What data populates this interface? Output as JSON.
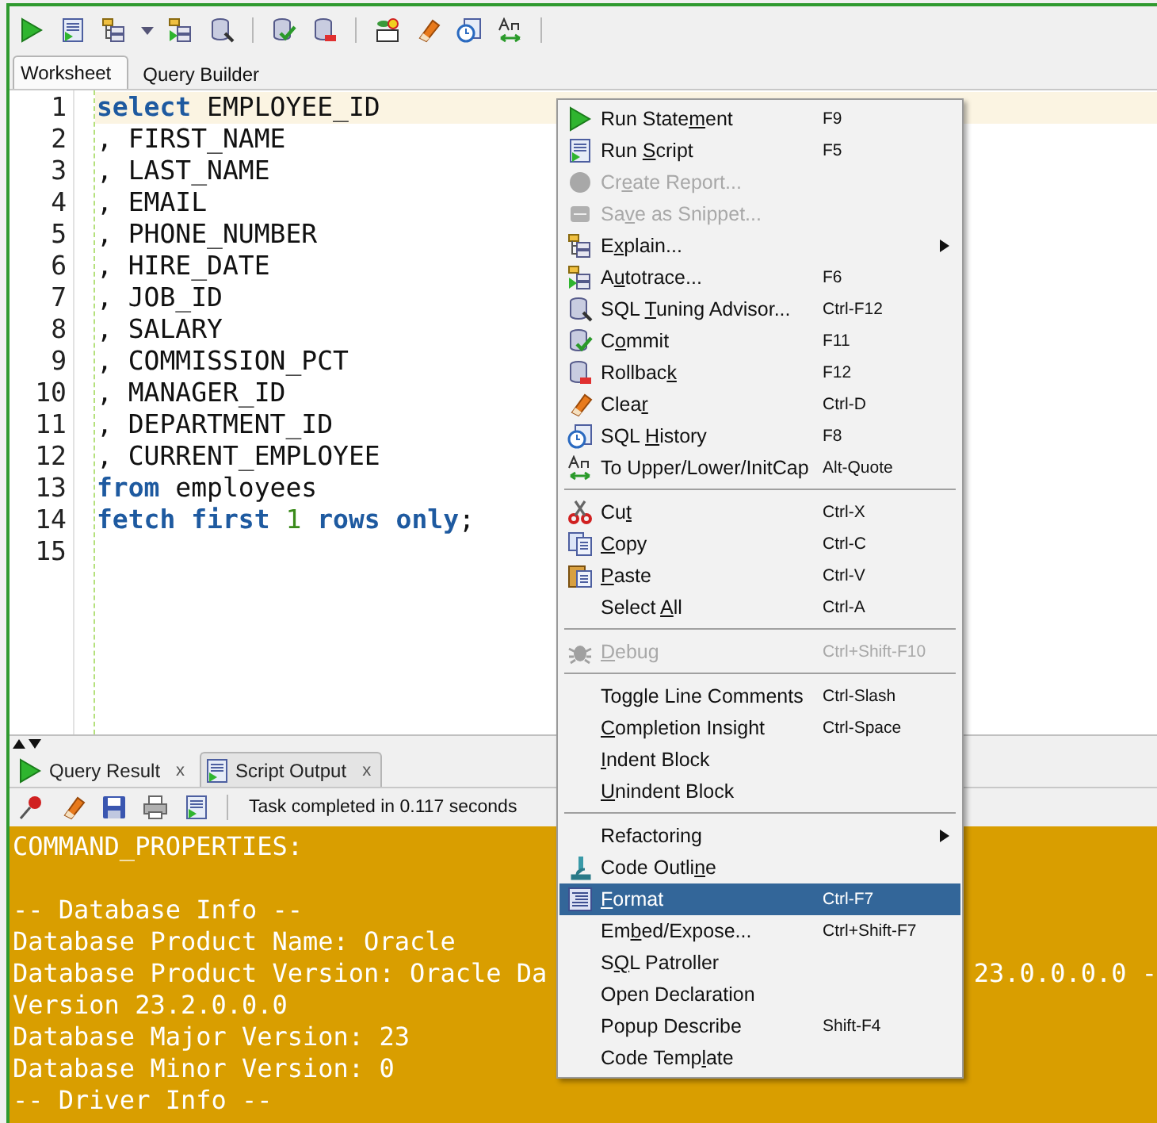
{
  "editor_tabs": [
    {
      "label": "Worksheet",
      "selected": true
    },
    {
      "label": "Query Builder",
      "selected": false
    }
  ],
  "code_lines": [
    {
      "number": "1",
      "current": true,
      "tokens": [
        {
          "kind": "keyword",
          "text": "select"
        },
        {
          "kind": "plain",
          "text": " EMPLOYEE_ID"
        }
      ]
    },
    {
      "number": "2",
      "current": false,
      "tokens": [
        {
          "kind": "plain",
          "text": ", FIRST_NAME"
        }
      ]
    },
    {
      "number": "3",
      "current": false,
      "tokens": [
        {
          "kind": "plain",
          "text": ", LAST_NAME"
        }
      ]
    },
    {
      "number": "4",
      "current": false,
      "tokens": [
        {
          "kind": "plain",
          "text": ", EMAIL"
        }
      ]
    },
    {
      "number": "5",
      "current": false,
      "tokens": [
        {
          "kind": "plain",
          "text": ", PHONE_NUMBER"
        }
      ]
    },
    {
      "number": "6",
      "current": false,
      "tokens": [
        {
          "kind": "plain",
          "text": ", HIRE_DATE"
        }
      ]
    },
    {
      "number": "7",
      "current": false,
      "tokens": [
        {
          "kind": "plain",
          "text": ", JOB_ID"
        }
      ]
    },
    {
      "number": "8",
      "current": false,
      "tokens": [
        {
          "kind": "plain",
          "text": ", SALARY"
        }
      ]
    },
    {
      "number": "9",
      "current": false,
      "tokens": [
        {
          "kind": "plain",
          "text": ", COMMISSION_PCT"
        }
      ]
    },
    {
      "number": "10",
      "current": false,
      "tokens": [
        {
          "kind": "plain",
          "text": ", MANAGER_ID"
        }
      ]
    },
    {
      "number": "11",
      "current": false,
      "tokens": [
        {
          "kind": "plain",
          "text": ", DEPARTMENT_ID"
        }
      ]
    },
    {
      "number": "12",
      "current": false,
      "tokens": [
        {
          "kind": "plain",
          "text": ", CURRENT_EMPLOYEE"
        }
      ]
    },
    {
      "number": "13",
      "current": false,
      "tokens": [
        {
          "kind": "keyword",
          "text": "from"
        },
        {
          "kind": "plain",
          "text": " employees"
        }
      ]
    },
    {
      "number": "14",
      "current": false,
      "tokens": [
        {
          "kind": "keyword",
          "text": "fetch first"
        },
        {
          "kind": "number",
          "text": " 1 "
        },
        {
          "kind": "keyword",
          "text": "rows only"
        },
        {
          "kind": "plain",
          "text": ";"
        }
      ]
    },
    {
      "number": "15",
      "current": false
    }
  ],
  "output_tabs": [
    {
      "label": "Query Result",
      "close": "x",
      "selected": false
    },
    {
      "label": "Script Output",
      "close": "x",
      "selected": true
    }
  ],
  "output_status": "Task completed in 0.117 seconds",
  "output_lines": [
    {
      "text": "COMMAND_PROPERTIES:",
      "blank_after": true
    },
    {
      "text": "-- Database Info --",
      "blank_after": false
    },
    {
      "text": "Database Product Name: Oracle",
      "blank_after": false
    },
    {
      "text": "Database Product Version: Oracle Da",
      "tail": "23.0.0.0.0 -",
      "blank_after": false
    },
    {
      "text": "Version 23.2.0.0.0",
      "blank_after": false
    },
    {
      "text": "Database Major Version: 23",
      "blank_after": false
    },
    {
      "text": "Database Minor Version: 0",
      "blank_after": false
    },
    {
      "text": "-- Driver Info --",
      "blank_after": false
    }
  ],
  "context_menu": [
    {
      "kind": "item",
      "label": {
        "text": "Run State",
        "key": "m",
        "rest": "ent"
      },
      "shortcut": "F9",
      "disabled": false,
      "selected": false,
      "submenu": false
    },
    {
      "kind": "item",
      "label": {
        "text": "Run ",
        "key": "S",
        "rest": "cript"
      },
      "shortcut": "F5",
      "disabled": false,
      "selected": false,
      "submenu": false
    },
    {
      "kind": "item",
      "label": {
        "text": "Cr",
        "key": "e",
        "rest": "ate Report..."
      },
      "disabled": true,
      "selected": false,
      "submenu": false
    },
    {
      "kind": "item",
      "label": {
        "text": "Sa",
        "key": "v",
        "rest": "e as Snippet..."
      },
      "disabled": true,
      "selected": false,
      "submenu": false
    },
    {
      "kind": "item",
      "label": {
        "text": "E",
        "key": "x",
        "rest": "plain..."
      },
      "disabled": false,
      "selected": false,
      "submenu": true
    },
    {
      "kind": "item",
      "label": {
        "text": "A",
        "key": "u",
        "rest": "totrace..."
      },
      "shortcut": "F6",
      "disabled": false,
      "selected": false,
      "submenu": false
    },
    {
      "kind": "item",
      "label": {
        "text": "SQL ",
        "key": "T",
        "rest": "uning Advisor..."
      },
      "shortcut": "Ctrl-F12",
      "disabled": false,
      "selected": false,
      "submenu": false
    },
    {
      "kind": "item",
      "label": {
        "text": "C",
        "key": "o",
        "rest": "mmit"
      },
      "shortcut": "F11",
      "disabled": false,
      "selected": false,
      "submenu": false
    },
    {
      "kind": "item",
      "label": {
        "text": "Rollbac",
        "key": "k"
      },
      "shortcut": "F12",
      "disabled": false,
      "selected": false,
      "submenu": false
    },
    {
      "kind": "item",
      "label": {
        "text": "Clea",
        "key": "r"
      },
      "shortcut": "Ctrl-D",
      "disabled": false,
      "selected": false,
      "submenu": false
    },
    {
      "kind": "item",
      "label": {
        "text": "SQL ",
        "key": "H",
        "rest": "istory"
      },
      "shortcut": "F8",
      "disabled": false,
      "selected": false,
      "submenu": false
    },
    {
      "kind": "item",
      "label": {
        "text": "To Upper/Lower/InitCap"
      },
      "shortcut": "Alt-Quote",
      "disabled": false,
      "selected": false,
      "submenu": false
    },
    {
      "kind": "separator"
    },
    {
      "kind": "item",
      "label": {
        "text": "Cu",
        "key": "t"
      },
      "shortcut": "Ctrl-X",
      "disabled": false,
      "selected": false,
      "submenu": false
    },
    {
      "kind": "item",
      "label": {
        "key": "C",
        "rest": "opy"
      },
      "shortcut": "Ctrl-C",
      "disabled": false,
      "selected": false,
      "submenu": false
    },
    {
      "kind": "item",
      "label": {
        "key": "P",
        "rest": "aste"
      },
      "shortcut": "Ctrl-V",
      "disabled": false,
      "selected": false,
      "submenu": false
    },
    {
      "kind": "item",
      "label": {
        "text": "Select ",
        "key": "A",
        "rest": "ll"
      },
      "shortcut": "Ctrl-A",
      "disabled": false,
      "selected": false,
      "submenu": false
    },
    {
      "kind": "separator"
    },
    {
      "kind": "item",
      "label": {
        "key": "D",
        "rest": "ebug"
      },
      "shortcut": "Ctrl+Shift-F10",
      "disabled": true,
      "selected": false,
      "submenu": false
    },
    {
      "kind": "separator"
    },
    {
      "kind": "item",
      "label": {
        "text": "Toggle Line Comments"
      },
      "shortcut": "Ctrl-Slash",
      "disabled": false,
      "selected": false,
      "submenu": false
    },
    {
      "kind": "item",
      "label": {
        "key": "C",
        "rest": "ompletion Insight"
      },
      "shortcut": "Ctrl-Space",
      "disabled": false,
      "selected": false,
      "submenu": false
    },
    {
      "kind": "item",
      "label": {
        "key": "I",
        "rest": "ndent Block"
      },
      "disabled": false,
      "selected": false,
      "submenu": false
    },
    {
      "kind": "item",
      "label": {
        "key": "U",
        "rest": "nindent Block"
      },
      "disabled": false,
      "selected": false,
      "submenu": false
    },
    {
      "kind": "separator"
    },
    {
      "kind": "item",
      "label": {
        "text": "Refactoring"
      },
      "disabled": false,
      "selected": false,
      "submenu": true
    },
    {
      "kind": "item",
      "label": {
        "text": "Code Outli",
        "key": "n",
        "rest": "e"
      },
      "disabled": false,
      "selected": false,
      "submenu": false
    },
    {
      "kind": "item",
      "label": {
        "key": "F",
        "rest": "ormat"
      },
      "shortcut": "Ctrl-F7",
      "disabled": false,
      "selected": true,
      "submenu": false
    },
    {
      "kind": "item",
      "label": {
        "text": "Em",
        "key": "b",
        "rest": "ed/Expose..."
      },
      "shortcut": "Ctrl+Shift-F7",
      "disabled": false,
      "selected": false,
      "submenu": false
    },
    {
      "kind": "item",
      "label": {
        "text": "S",
        "key": "Q",
        "rest": "L Patroller"
      },
      "disabled": false,
      "selected": false,
      "submenu": false
    },
    {
      "kind": "item",
      "label": {
        "text": "Open Declaration"
      },
      "disabled": false,
      "selected": false,
      "submenu": false
    },
    {
      "kind": "item",
      "label": {
        "text": "Popup Describe"
      },
      "shortcut": "Shift-F4",
      "disabled": false,
      "selected": false,
      "submenu": false
    },
    {
      "kind": "item",
      "label": {
        "text": "Code Temp",
        "key": "l",
        "rest": "ate"
      },
      "disabled": false,
      "selected": false,
      "submenu": false
    }
  ]
}
